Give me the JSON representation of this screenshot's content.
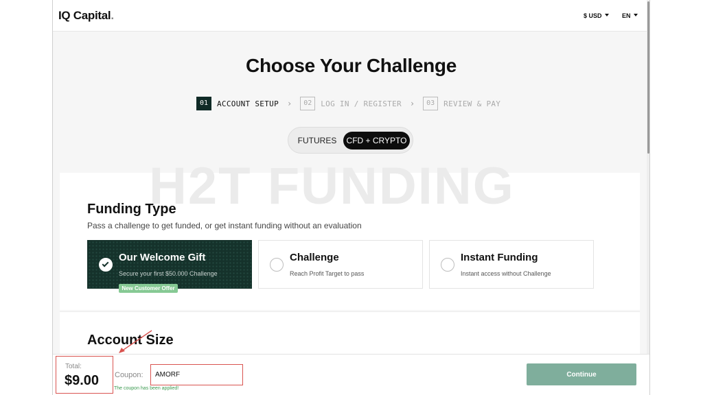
{
  "header": {
    "logo": "IQ Capital",
    "logo_dot": ".",
    "currency": "$ USD",
    "language": "EN"
  },
  "page": {
    "title": "Choose Your Challenge"
  },
  "steps": [
    {
      "num": "01",
      "label": "ACCOUNT SETUP",
      "active": true
    },
    {
      "num": "02",
      "label": "LOG IN / REGISTER",
      "active": false
    },
    {
      "num": "03",
      "label": "REVIEW & PAY",
      "active": false
    }
  ],
  "toggle": {
    "options": [
      "FUTURES",
      "CFD + CRYPTO"
    ],
    "selected": "CFD + CRYPTO"
  },
  "watermark": "H2T FUNDING",
  "funding_type": {
    "title": "Funding Type",
    "subtitle": "Pass a challenge to get funded, or get instant funding without an evaluation",
    "options": [
      {
        "title": "Our Welcome Gift",
        "desc": "Secure your first $50.000 Challenge",
        "selected": true,
        "badge": "New Customer Offer"
      },
      {
        "title": "Challenge",
        "desc": "Reach Profit Target to pass",
        "selected": false
      },
      {
        "title": "Instant Funding",
        "desc": "Instant access without Challenge",
        "selected": false
      }
    ]
  },
  "account_size": {
    "title": "Account Size"
  },
  "footer": {
    "total_label": "Total:",
    "total_value": "$9.00",
    "coupon_label": "Coupon:",
    "coupon_value": "AMORF",
    "coupon_message": "The coupon has been applied!",
    "continue_label": "Continue"
  },
  "colors": {
    "selected_card": "#15322b",
    "continue_button": "#7fae9c",
    "annotation": "#d9534f",
    "success_text": "#3a9a4f",
    "badge": "#86c994"
  }
}
